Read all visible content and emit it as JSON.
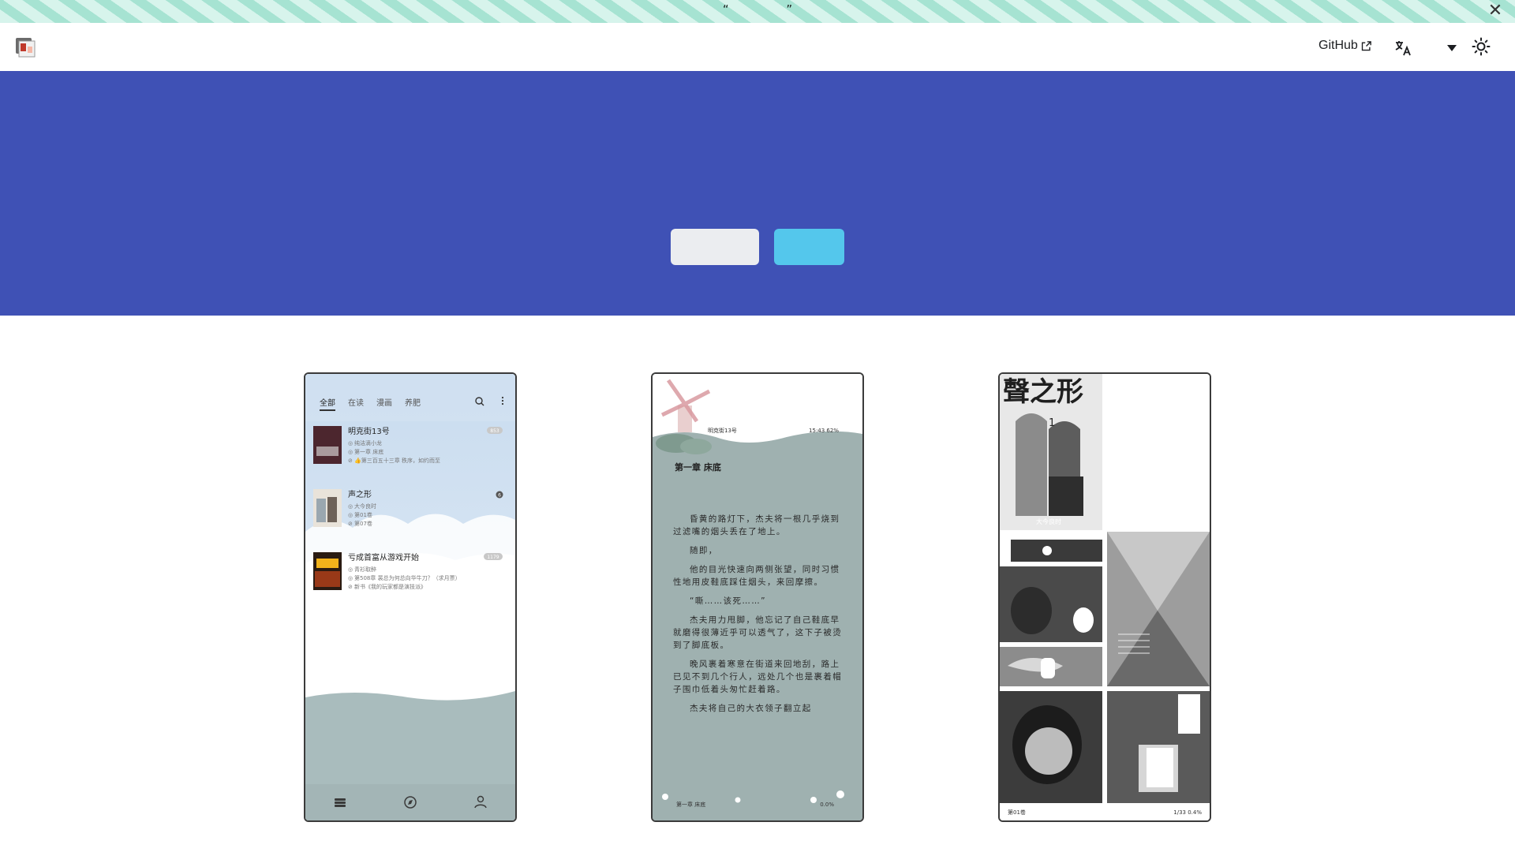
{
  "announcement": {
    "text": "“ ”",
    "close_icon": "close-icon"
  },
  "navbar": {
    "logo_icon": "app-logo",
    "github_label": "GitHub",
    "external_link_icon": "external-link-icon",
    "translate_icon": "translate-icon",
    "dropdown_icon": "caret-down-icon",
    "theme_icon": "sun-icon"
  },
  "hero": {
    "background": "#3f51b5",
    "secondary_button_color": "#ebedf0",
    "info_button_color": "#54c7ec"
  },
  "screenshots": {
    "bookshelf": {
      "tabs": [
        "全部",
        "在读",
        "漫画",
        "养肥"
      ],
      "books": [
        {
          "title": "明克街13号",
          "author": "纯洁滴小龙",
          "read": "第一章 床底",
          "latest": "👍第三百五十三章 秩序，如约而至",
          "badge": "853"
        },
        {
          "title": "声之形",
          "author": "大今良时",
          "read": "第01卷",
          "latest": "第07卷",
          "badge": "6"
        },
        {
          "title": "亏成首富从游戏开始",
          "author": "青衫取醉",
          "read": "第508章 裴总为何总向华牛刀？（求月票）",
          "latest": "新书《我的玩家都是演技派》",
          "badge": "1179"
        }
      ],
      "bottom_icons": [
        "bookshelf-icon",
        "compass-icon",
        "user-icon"
      ]
    },
    "reader": {
      "book_title": "明克街13号",
      "status": "15:43 62%",
      "chapter_title": "第一章 床底",
      "paragraphs": [
        "昏黄的路灯下，杰夫将一根几乎烧到过滤嘴的烟头丢在了地上。",
        "随即，",
        "他的目光快速向两侧张望，同时习惯性地用皮鞋底踩住烟头，来回摩擦。",
        "“嘶……该死……”",
        "杰夫用力甩脚，他忘记了自己鞋底早就磨得很薄近乎可以透气了，这下子被烫到了脚底板。",
        "晚风裹着寒意在街道来回地刮，路上已见不到几个行人，远处几个也是裹着帽子围巾低着头匆忙赶着路。",
        "杰夫将自己的大衣领子翻立起"
      ],
      "footer_left": "第一章 床底",
      "footer_right": "0.0%"
    },
    "manga": {
      "cover_title": "聲之形",
      "volume_number": "1",
      "author": "大今良时",
      "footer_left": "第01卷",
      "footer_right": "1/33 0.4%"
    }
  }
}
